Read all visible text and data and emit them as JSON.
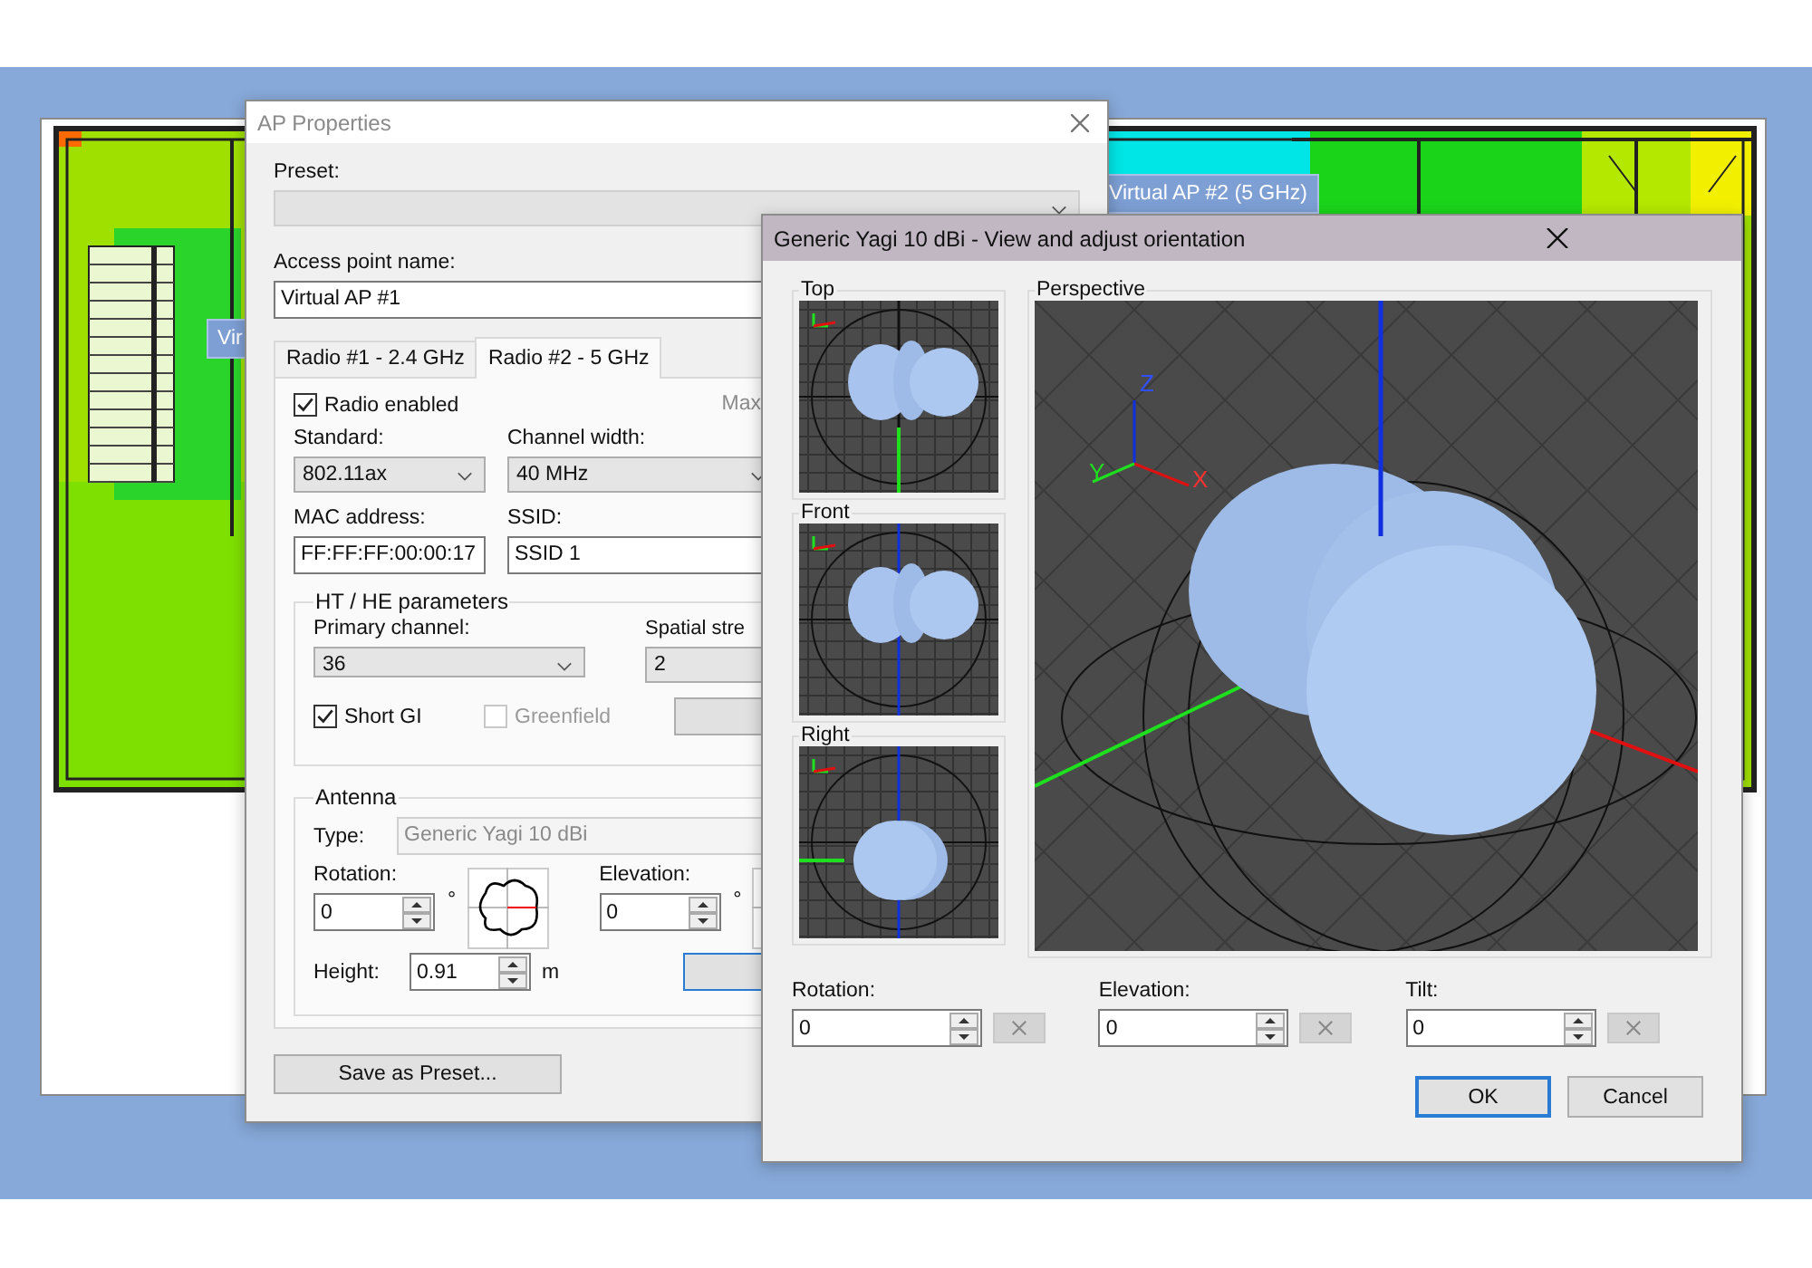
{
  "floor_plan": {
    "ap_labels": [
      {
        "text": "Vir"
      },
      {
        "text": "Virtual AP #2 (5 GHz)"
      }
    ]
  },
  "ap_properties": {
    "title": "AP Properties",
    "preset": {
      "label": "Preset:",
      "disabled": true
    },
    "name": {
      "label": "Access point name:",
      "value": "Virtual AP #1"
    },
    "tabs": [
      {
        "label": "Radio #1 - 2.4 GHz",
        "selected": false
      },
      {
        "label": "Radio #2 - 5 GHz",
        "selected": true
      }
    ],
    "radio_enabled": {
      "label": "Radio enabled",
      "checked": true
    },
    "max_label": "Max",
    "standard": {
      "label": "Standard:",
      "value": "802.11ax"
    },
    "channel_width": {
      "label": "Channel width:",
      "value": "40 MHz"
    },
    "mac": {
      "label": "MAC address:",
      "value": "FF:FF:FF:00:00:17"
    },
    "ssid": {
      "label": "SSID:",
      "value": "SSID 1"
    },
    "ht_group": {
      "title": "HT / HE parameters",
      "primary_channel": {
        "label": "Primary channel:",
        "value": "36"
      },
      "spatial_streams": {
        "label": "Spatial stre",
        "value": "2"
      },
      "short_gi": {
        "label": "Short GI",
        "checked": true,
        "disabled": false
      },
      "greenfield": {
        "label": "Greenfield",
        "checked": false,
        "disabled": true
      }
    },
    "antenna": {
      "title": "Antenna",
      "type": {
        "label": "Type:",
        "value": "Generic Yagi 10 dBi",
        "disabled": true
      },
      "rotation": {
        "label": "Rotation:",
        "value": "0",
        "unit": "°"
      },
      "elevation": {
        "label": "Elevation:",
        "value": "0",
        "unit": "°"
      },
      "height": {
        "label": "Height:",
        "value": "0.91",
        "unit": "m"
      }
    },
    "save_button": "Save as Preset..."
  },
  "orientation_dialog": {
    "title": "Generic Yagi 10 dBi - View and adjust orientation",
    "views": [
      {
        "label": "Top"
      },
      {
        "label": "Front"
      },
      {
        "label": "Right"
      }
    ],
    "perspective": {
      "label": "Perspective",
      "axes": [
        "Z",
        "Y",
        "X"
      ]
    },
    "fields": [
      {
        "label": "Rotation:",
        "value": "0"
      },
      {
        "label": "Elevation:",
        "value": "0"
      },
      {
        "label": "Tilt:",
        "value": "0"
      }
    ],
    "buttons": [
      {
        "label": "OK",
        "default": true
      },
      {
        "label": "Cancel",
        "default": false
      }
    ]
  }
}
